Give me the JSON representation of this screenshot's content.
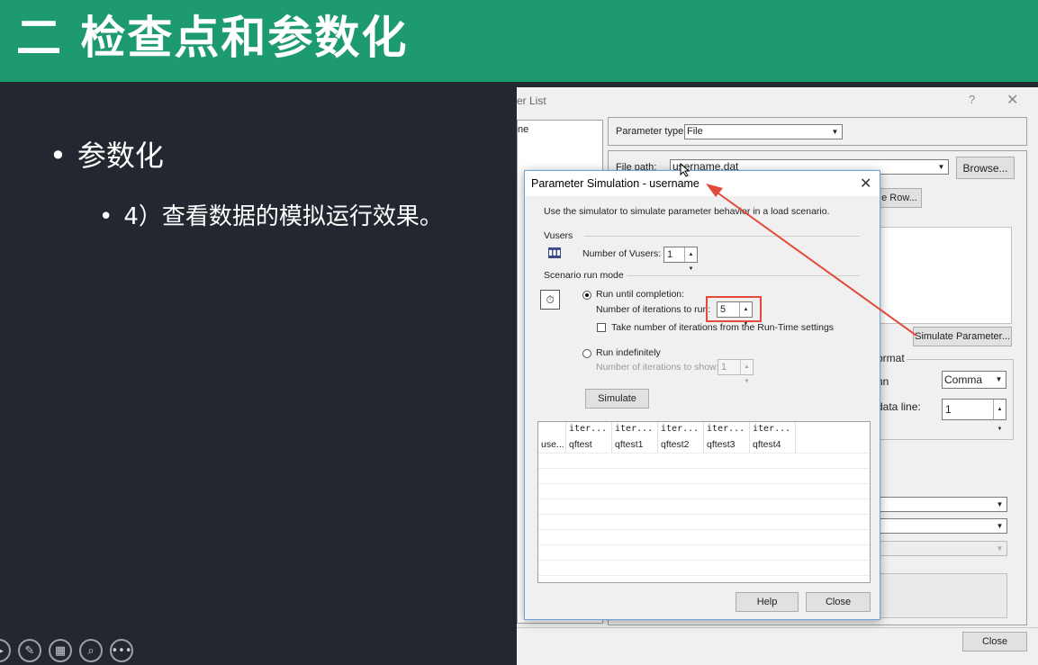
{
  "slide": {
    "title": "二 检查点和参数化",
    "bullet1": "参数化",
    "bullet2": "4）查看数据的模拟运行效果。",
    "bullet_dot": "•",
    "tools": [
      "play-icon",
      "pen-icon",
      "slides-icon",
      "zoom-icon",
      "more-icon"
    ]
  },
  "background_window": {
    "title": "er List",
    "help": "?",
    "close": "✕",
    "list_item": "ne",
    "parameter_type_label": "Parameter type:",
    "parameter_type_value": "File",
    "file_path_label": "File path:",
    "file_path_value": "username.dat",
    "browse_label": "Browse...",
    "row_button_label": "e Row...",
    "simulate_parameter_label": "Simulate Parameter...",
    "format_label": "ormat",
    "column_label": "nn",
    "column_value": "Comma",
    "first_data_line_label": "data line:",
    "first_data_line_value": "1",
    "close_label": "Close"
  },
  "dialog": {
    "title": "Parameter Simulation - username",
    "close": "✕",
    "description": "Use the simulator to simulate parameter behavior in a load scenario.",
    "vusers_group": "Vusers",
    "num_vusers_label": "Number of Vusers:",
    "num_vusers_value": "1",
    "scenario_group": "Scenario run mode",
    "run_until_completion": "Run until completion:",
    "iterations_label": "Number of iterations to run:",
    "iterations_value": "5",
    "take_iterations_label": "Take number of iterations from the Run-Time settings",
    "run_indefinitely": "Run indefinitely",
    "iterations_show_label": "Number of iterations to show:",
    "iterations_show_value": "1",
    "simulate_label": "Simulate",
    "grid_headers": [
      "",
      "iter...",
      "iter...",
      "iter...",
      "iter...",
      "iter..."
    ],
    "grid_rows": [
      [
        "use...",
        "qftest",
        "qftest1",
        "qftest2",
        "qftest3",
        "qftest4"
      ]
    ],
    "help_label": "Help",
    "close_label": "Close"
  },
  "colors": {
    "header_green": "#1d9b6e",
    "slide_bg": "#232730",
    "annotation_red": "#e24b3b"
  }
}
